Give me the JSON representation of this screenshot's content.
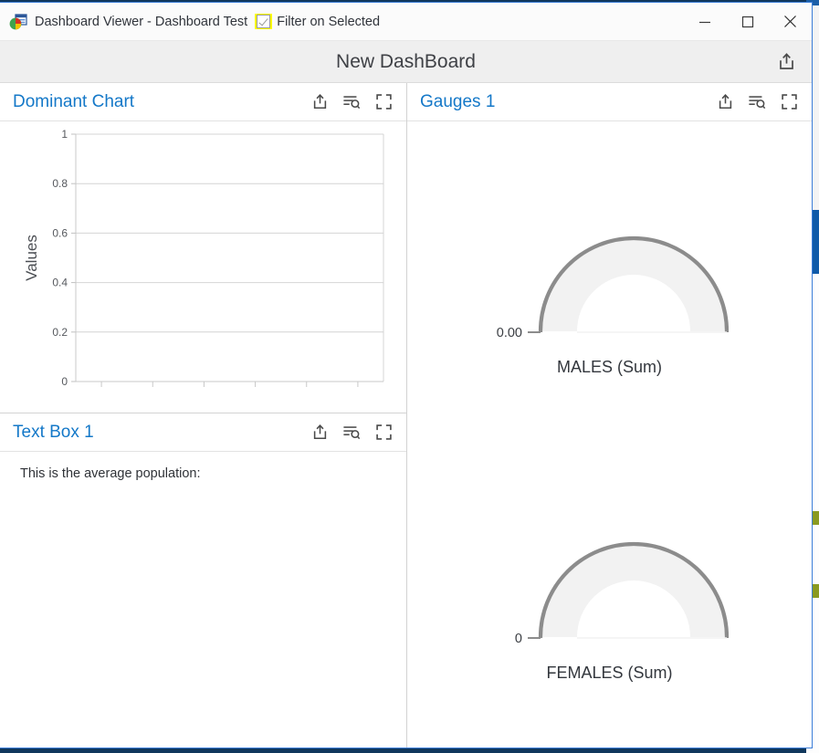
{
  "window": {
    "app_icon": "dashboard-app-icon",
    "title": "Dashboard Viewer - Dashboard Test",
    "filter_checkbox": {
      "label": "Filter on Selected",
      "checked": true,
      "highlight_color": "#ffff00"
    },
    "controls": {
      "minimize": "minimize-icon",
      "maximize": "maximize-icon",
      "close": "close-icon"
    }
  },
  "dashboard": {
    "title": "New DashBoard",
    "export_icon": "export-icon"
  },
  "panels": [
    {
      "id": "dominant-chart",
      "title": "Dominant Chart",
      "title_color": "#1478c8",
      "tools": [
        "export-icon",
        "filter-list-icon",
        "expand-icon"
      ]
    },
    {
      "id": "text-box-1",
      "title": "Text Box 1",
      "title_color": "#1478c8",
      "tools": [
        "export-icon",
        "filter-list-icon",
        "expand-icon"
      ],
      "content": "This is the average population:"
    },
    {
      "id": "gauges-1",
      "title": "Gauges 1",
      "title_color": "#1478c8",
      "tools": [
        "export-icon",
        "filter-list-icon",
        "expand-icon"
      ]
    }
  ],
  "chart_data": {
    "type": "line",
    "title": "",
    "xlabel": "",
    "ylabel": "Values",
    "ylim": [
      0,
      1
    ],
    "yticks": [
      "0",
      "0.2",
      "0.4",
      "0.6",
      "0.8",
      "1"
    ],
    "ytick_values": [
      0,
      0.2,
      0.4,
      0.6,
      0.8,
      1
    ],
    "xticks": [
      "",
      "",
      "",
      "",
      "",
      ""
    ],
    "xtick_count": 6,
    "series": [],
    "values": [],
    "grid": true,
    "legend": false,
    "empty": true
  },
  "gauges": [
    {
      "name": "gauge-males",
      "min_label": "0.00",
      "caption": "MALES (Sum)",
      "value": 0,
      "arc_color": "#8c8c8c",
      "track_color": "#f2f2f2"
    },
    {
      "name": "gauge-females",
      "min_label": "0",
      "caption": "FEMALES (Sum)",
      "value": 0,
      "arc_color": "#8c8c8c",
      "track_color": "#f2f2f2"
    }
  ]
}
